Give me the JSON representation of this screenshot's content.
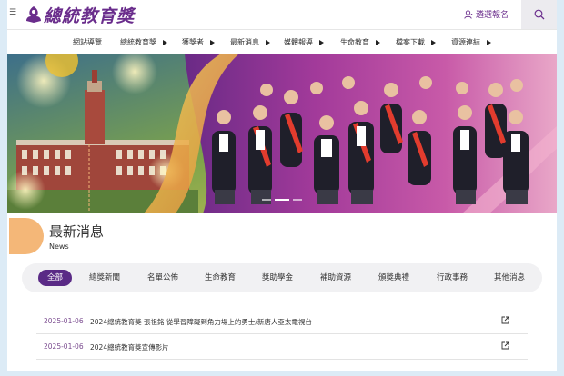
{
  "header": {
    "logo_text": "總統教育獎",
    "signup_label": "遴選報名"
  },
  "nav": {
    "items": [
      {
        "label": "網站導覽",
        "has_arrow": false
      },
      {
        "label": "總統教育獎",
        "has_arrow": true
      },
      {
        "label": "獲獎者",
        "has_arrow": true
      },
      {
        "label": "最新消息",
        "has_arrow": true
      },
      {
        "label": "媒體報導",
        "has_arrow": true
      },
      {
        "label": "生命教育",
        "has_arrow": true
      },
      {
        "label": "檔案下載",
        "has_arrow": true
      },
      {
        "label": "資源連結",
        "has_arrow": true
      }
    ]
  },
  "news": {
    "title": "最新消息",
    "subtitle": "News",
    "tabs": [
      {
        "label": "全部",
        "active": true
      },
      {
        "label": "總獎新聞",
        "active": false
      },
      {
        "label": "名單公佈",
        "active": false
      },
      {
        "label": "生命教育",
        "active": false
      },
      {
        "label": "獎助學金",
        "active": false
      },
      {
        "label": "補助資源",
        "active": false
      },
      {
        "label": "頒獎典禮",
        "active": false
      },
      {
        "label": "行政事務",
        "active": false
      },
      {
        "label": "其他消息",
        "active": false
      }
    ],
    "items": [
      {
        "date": "2025-01-06",
        "title": "2024總統教育獎 張祖銘 從學習障礙到角力場上的勇士/新唐人亞太電視台"
      },
      {
        "date": "2025-01-06",
        "title": "2024總統教育獎宣傳影片"
      }
    ]
  },
  "colors": {
    "brand_purple": "#5a2a86",
    "accent_orange": "#f4b778",
    "frame_blue": "#dcebf6"
  }
}
